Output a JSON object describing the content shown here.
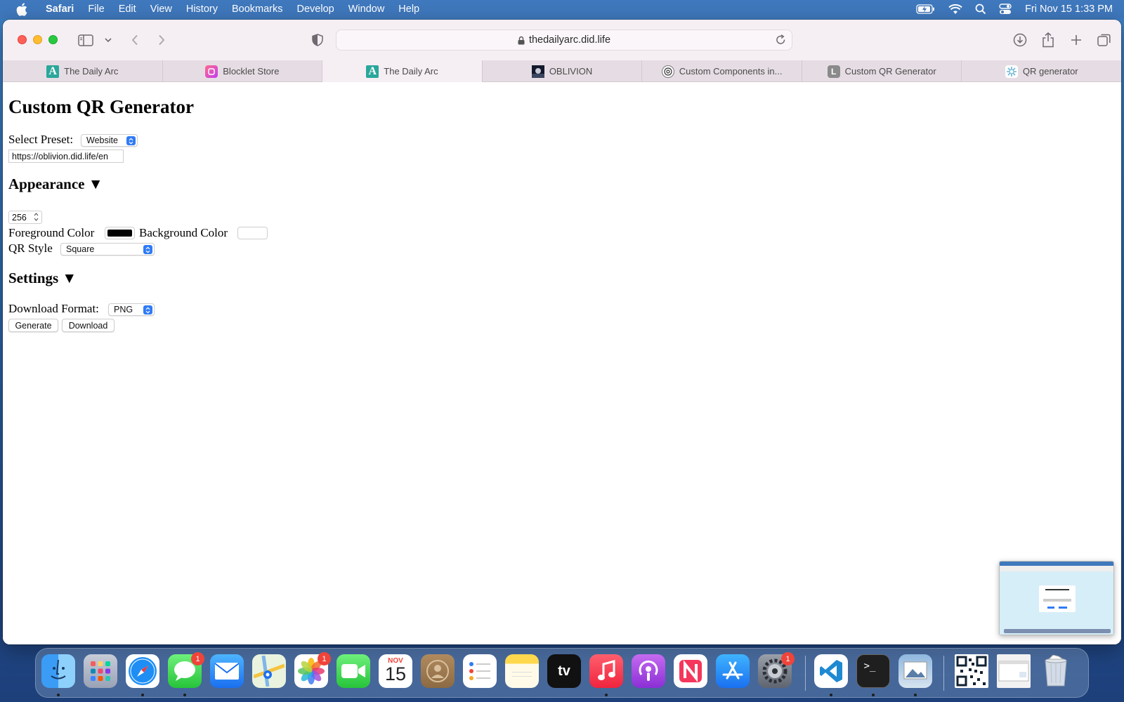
{
  "menubar": {
    "app_name": "Safari",
    "items": [
      "File",
      "Edit",
      "View",
      "History",
      "Bookmarks",
      "Develop",
      "Window",
      "Help"
    ],
    "clock": "Fri Nov 15  1:33 PM",
    "status_icons": [
      "battery-icon",
      "wifi-icon",
      "spotlight-icon",
      "control-center-icon"
    ]
  },
  "browser": {
    "url": "thedailyarc.did.life",
    "tabs": [
      {
        "label": "The Daily Arc",
        "icon": "arc-icon",
        "active": false
      },
      {
        "label": "Blocklet Store",
        "icon": "blocklet-icon",
        "active": false
      },
      {
        "label": "The Daily Arc",
        "icon": "arc-icon",
        "active": true
      },
      {
        "label": "OBLIVION",
        "icon": "oblivion-icon",
        "active": false
      },
      {
        "label": "Custom Components in...",
        "icon": "openai-icon",
        "active": false
      },
      {
        "label": "Custom QR Generator",
        "icon": "letter-l-icon",
        "active": false
      },
      {
        "label": "QR generator",
        "icon": "qr-icon",
        "active": false
      }
    ]
  },
  "page": {
    "title": "Custom QR Generator",
    "preset_label": "Select Preset:",
    "preset_value": "Website",
    "url_value": "https://oblivion.did.life/en",
    "appearance_heading": "Appearance ▼",
    "size_value": "256",
    "foreground_label": "Foreground Color",
    "foreground_color": "#000000",
    "background_label": "Background Color",
    "background_color": "#ffffff",
    "qr_style_label": "QR Style",
    "qr_style_value": "Square",
    "settings_heading": "Settings ▼",
    "download_format_label": "Download Format:",
    "download_format_value": "PNG",
    "generate_label": "Generate",
    "download_label": "Download"
  },
  "dock": {
    "calendar_month": "NOV",
    "calendar_day": "15",
    "messages_badge": "1",
    "photos_badge": "1",
    "settings_badge": "1"
  },
  "colors": {
    "accent": "#2f7bf6",
    "menubar": "#3f78bd",
    "toolbar": "#f5eef3"
  }
}
